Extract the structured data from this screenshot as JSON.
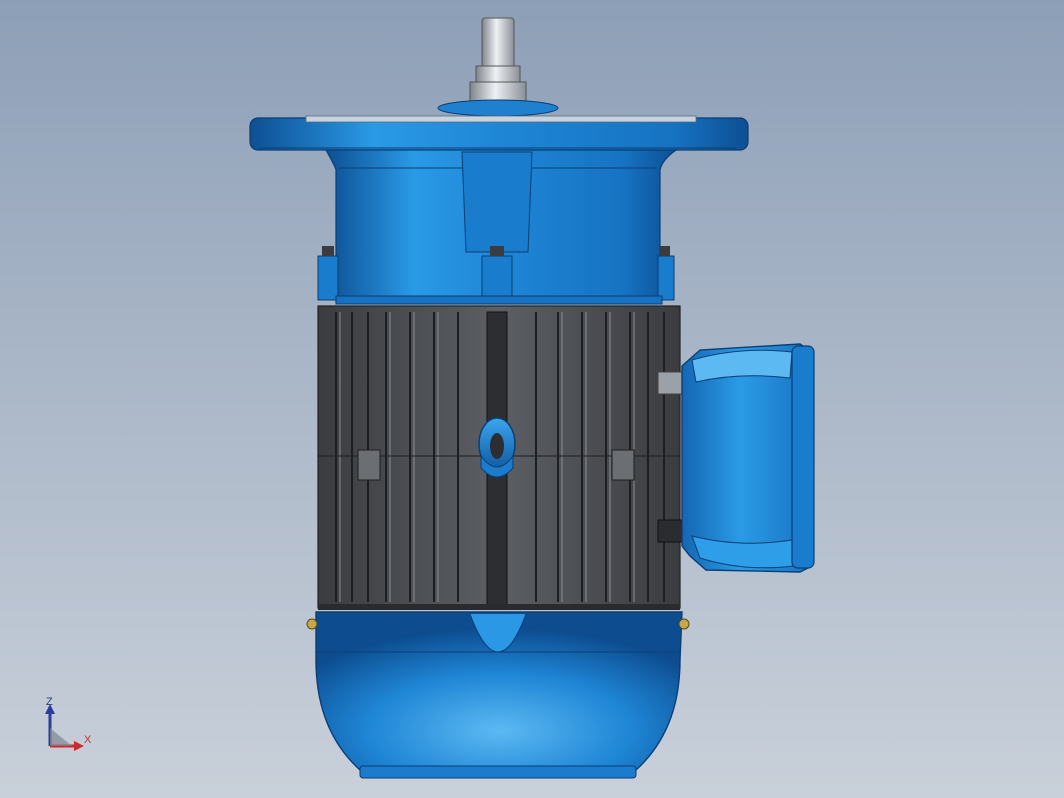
{
  "viewport": {
    "background_top": "#8d9fb7",
    "background_bottom": "#c9d0da"
  },
  "model": {
    "body_color": "#1f86d6",
    "body_dark": "#0d4f93",
    "body_highlight": "#5cb9f2",
    "fin_color": "#55575c",
    "fin_dark": "#2e3033",
    "shaft_color": "#b9bec4"
  },
  "triad": {
    "z_label": "Z",
    "x_label": "X",
    "z_color": "#2a3d9a",
    "x_color": "#d02828"
  }
}
